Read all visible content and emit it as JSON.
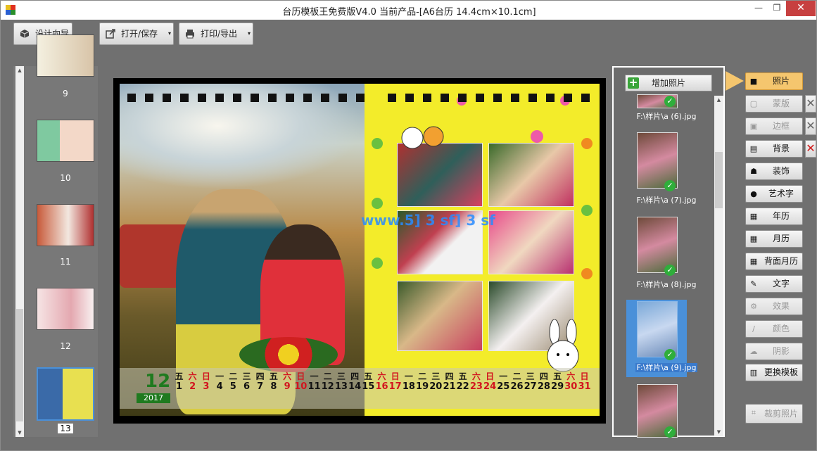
{
  "window": {
    "title": "台历模板王免费版V4.0    当前产品-[A6台历 14.4cm×10.1cm]",
    "min_glyph": "—",
    "max_glyph": "❐",
    "close_glyph": "✕"
  },
  "toolbar": {
    "wizard_label": "设计向导",
    "open_save_label": "打开/保存",
    "print_export_label": "打印/导出",
    "dropdown_glyph": "▾"
  },
  "thumbnails": {
    "labels": [
      "9",
      "10",
      "11",
      "12",
      "13"
    ],
    "selected": "13"
  },
  "calendar": {
    "month": "12",
    "year": "2017",
    "weekdays": [
      "五",
      "六",
      "日",
      "一",
      "二",
      "三",
      "四",
      "五",
      "六",
      "日",
      "一",
      "二",
      "三",
      "四",
      "五",
      "六",
      "日",
      "一",
      "二",
      "三",
      "四",
      "五",
      "六",
      "日",
      "一",
      "二",
      "三",
      "四",
      "五",
      "六",
      "日"
    ],
    "days": [
      "1",
      "2",
      "3",
      "4",
      "5",
      "6",
      "7",
      "8",
      "9",
      "10",
      "11",
      "12",
      "13",
      "14",
      "15",
      "16",
      "17",
      "18",
      "19",
      "20",
      "21",
      "22",
      "23",
      "24",
      "25",
      "26",
      "27",
      "28",
      "29",
      "30",
      "31"
    ],
    "weekend_color": "#d2141e",
    "weekday_color": "#111111",
    "watermark": "www.5] 3 sf] 3 sf"
  },
  "photo_panel": {
    "add_label": "增加照片",
    "add_glyph": "+",
    "check_glyph": "✓",
    "items": [
      {
        "name": "F:\\样片\\a (6).jpg"
      },
      {
        "name": "F:\\样片\\a (7).jpg"
      },
      {
        "name": "F:\\样片\\a (8).jpg"
      },
      {
        "name": "F:\\样片\\a (9).jpg"
      }
    ],
    "selected": "F:\\样片\\a (9).jpg"
  },
  "side_buttons": {
    "photo": "照片",
    "mask": "蒙版",
    "frame": "边框",
    "background": "背景",
    "decoration": "装饰",
    "art_text": "艺术字",
    "year_cal": "年历",
    "month_cal": "月历",
    "back_month_cal": "背面月历",
    "text": "文字",
    "effect": "效果",
    "color": "颜色",
    "shadow": "阴影",
    "change_template": "更换模板",
    "crop_photo": "裁剪照片",
    "remove_glyph": "✕"
  },
  "colors": {
    "accent": "#f5c66e",
    "calendar_bg": "#f3ec2a",
    "check_green": "#2fae3b",
    "selected_photo": "#4a90d9"
  }
}
